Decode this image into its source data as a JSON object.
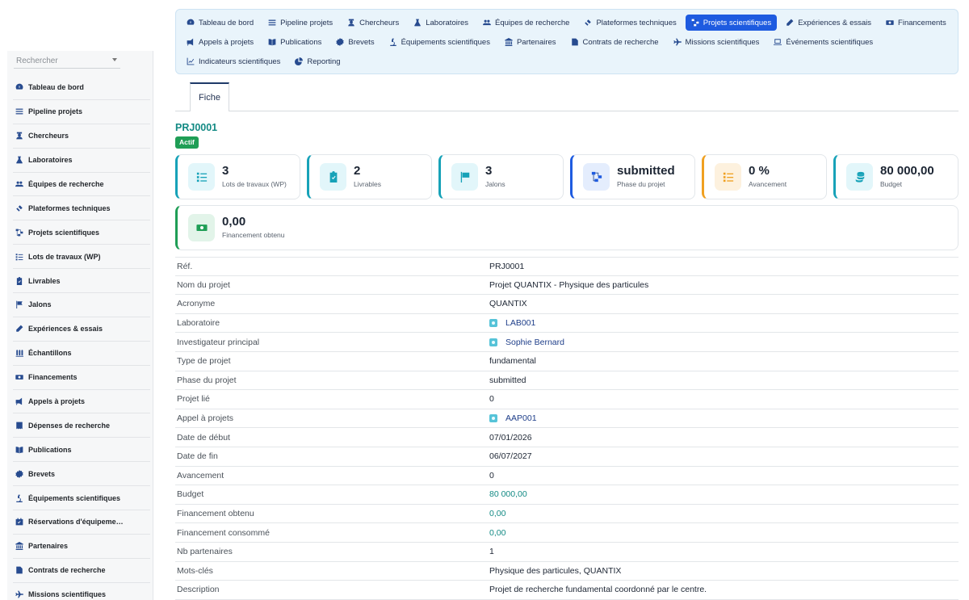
{
  "sidebar": {
    "search_placeholder": "Rechercher",
    "items": [
      {
        "label": "Tableau de bord",
        "icon": "dashboard-icon"
      },
      {
        "label": "Pipeline projets",
        "icon": "list-icon"
      },
      {
        "label": "Chercheurs",
        "icon": "user-icon"
      },
      {
        "label": "Laboratoires",
        "icon": "flask-icon"
      },
      {
        "label": "Équipes de recherche",
        "icon": "users-icon"
      },
      {
        "label": "Plateformes techniques",
        "icon": "satellite-icon"
      },
      {
        "label": "Projets scientifiques",
        "icon": "project-diagram-icon"
      },
      {
        "label": "Lots de travaux (WP)",
        "icon": "tasks-icon"
      },
      {
        "label": "Livrables",
        "icon": "clipboard-check-icon"
      },
      {
        "label": "Jalons",
        "icon": "flag-icon"
      },
      {
        "label": "Expériences & essais",
        "icon": "pen-icon"
      },
      {
        "label": "Échantillons",
        "icon": "vials-icon"
      },
      {
        "label": "Financements",
        "icon": "money-icon"
      },
      {
        "label": "Appels à projets",
        "icon": "bullhorn-icon"
      },
      {
        "label": "Dépenses de recherche",
        "icon": "receipt-icon"
      },
      {
        "label": "Publications",
        "icon": "book-icon"
      },
      {
        "label": "Brevets",
        "icon": "certificate-icon"
      },
      {
        "label": "Équipements scientifiques",
        "icon": "microscope-icon"
      },
      {
        "label": "Réservations d'équipeme…",
        "icon": "calendar-check-icon"
      },
      {
        "label": "Partenaires",
        "icon": "bank-icon"
      },
      {
        "label": "Contrats de recherche",
        "icon": "contract-icon"
      },
      {
        "label": "Missions scientifiques",
        "icon": "plane-icon"
      }
    ]
  },
  "topnav": {
    "rows": [
      [
        {
          "label": "Tableau de bord",
          "icon": "dashboard-icon"
        },
        {
          "label": "Pipeline projets",
          "icon": "list-icon"
        },
        {
          "label": "Chercheurs",
          "icon": "user-icon"
        },
        {
          "label": "Laboratoires",
          "icon": "flask-icon"
        },
        {
          "label": "Équipes de recherche",
          "icon": "users-icon"
        },
        {
          "label": "Plateformes techniques",
          "icon": "satellite-icon"
        },
        {
          "label": "Projets scientifiques",
          "icon": "project-diagram-icon",
          "active": true
        },
        {
          "label": "Expériences & essais",
          "icon": "pen-icon"
        },
        {
          "label": "Financements",
          "icon": "money-icon"
        }
      ],
      [
        {
          "label": "Appels à projets",
          "icon": "bullhorn-icon"
        },
        {
          "label": "Publications",
          "icon": "book-icon"
        },
        {
          "label": "Brevets",
          "icon": "certificate-icon"
        },
        {
          "label": "Équipements scientifiques",
          "icon": "microscope-icon"
        },
        {
          "label": "Partenaires",
          "icon": "bank-icon"
        },
        {
          "label": "Contrats de recherche",
          "icon": "contract-icon"
        },
        {
          "label": "Missions scientifiques",
          "icon": "plane-icon"
        },
        {
          "label": "Événements scientifiques",
          "icon": "laptop-icon"
        }
      ],
      [
        {
          "label": "Indicateurs scientifiques",
          "icon": "chart-line-icon"
        },
        {
          "label": "Reporting",
          "icon": "pie-chart-icon"
        }
      ]
    ]
  },
  "tabs": {
    "fiche": "Fiche"
  },
  "record": {
    "id": "PRJ0001",
    "status": "Actif"
  },
  "colors": {
    "accent": "#1e5be0",
    "teal": "#138a84",
    "status_green": "#1f9e56"
  },
  "cards": [
    {
      "value": "3",
      "label": "Lots de travaux (WP)",
      "icon": "tasks-icon",
      "color": "#17a2b8",
      "bg": "#e2f6fa"
    },
    {
      "value": "2",
      "label": "Livrables",
      "icon": "clipboard-check-icon",
      "color": "#17a2b8",
      "bg": "#e2f6fa"
    },
    {
      "value": "3",
      "label": "Jalons",
      "icon": "flag-checkered-icon",
      "color": "#17a2b8",
      "bg": "#e2f6fa"
    },
    {
      "value": "submitted",
      "label": "Phase du projet",
      "icon": "project-diagram-icon",
      "color": "#1e5be0",
      "bg": "#e4edfd"
    },
    {
      "value": "0 %",
      "label": "Avancement",
      "icon": "tasks-icon",
      "color": "#f0a020",
      "bg": "#fdf1de"
    },
    {
      "value": "80 000,00",
      "label": "Budget",
      "icon": "coins-icon",
      "color": "#17a2b8",
      "bg": "#e2f6fa"
    },
    {
      "value": "0,00",
      "label": "Financement obtenu",
      "icon": "money-bill-icon",
      "color": "#1f9e56",
      "bg": "#e2f4e9"
    }
  ],
  "details": [
    {
      "key": "Réf.",
      "value": "PRJ0001"
    },
    {
      "key": "Nom du projet",
      "value": "Projet QUANTIX - Physique des particules"
    },
    {
      "key": "Acronyme",
      "value": "QUANTIX"
    },
    {
      "key": "Laboratoire",
      "value": "LAB001",
      "type": "link"
    },
    {
      "key": "Investigateur principal",
      "value": "Sophie Bernard",
      "type": "link"
    },
    {
      "key": "Type de projet",
      "value": "fundamental"
    },
    {
      "key": "Phase du projet",
      "value": "submitted"
    },
    {
      "key": "Projet lié",
      "value": "0"
    },
    {
      "key": "Appel à projets",
      "value": "AAP001",
      "type": "link"
    },
    {
      "key": "Date de début",
      "value": "07/01/2026"
    },
    {
      "key": "Date de fin",
      "value": "06/07/2027"
    },
    {
      "key": "Avancement",
      "value": "0"
    },
    {
      "key": "Budget",
      "value": "80 000,00",
      "type": "money"
    },
    {
      "key": "Financement obtenu",
      "value": "0,00",
      "type": "money"
    },
    {
      "key": "Financement consommé",
      "value": "0,00",
      "type": "money"
    },
    {
      "key": "Nb partenaires",
      "value": "1"
    },
    {
      "key": "Mots-clés",
      "value": "Physique des particules, QUANTIX"
    },
    {
      "key": "Description",
      "value": "Projet de recherche fundamental coordonné par le centre."
    }
  ]
}
